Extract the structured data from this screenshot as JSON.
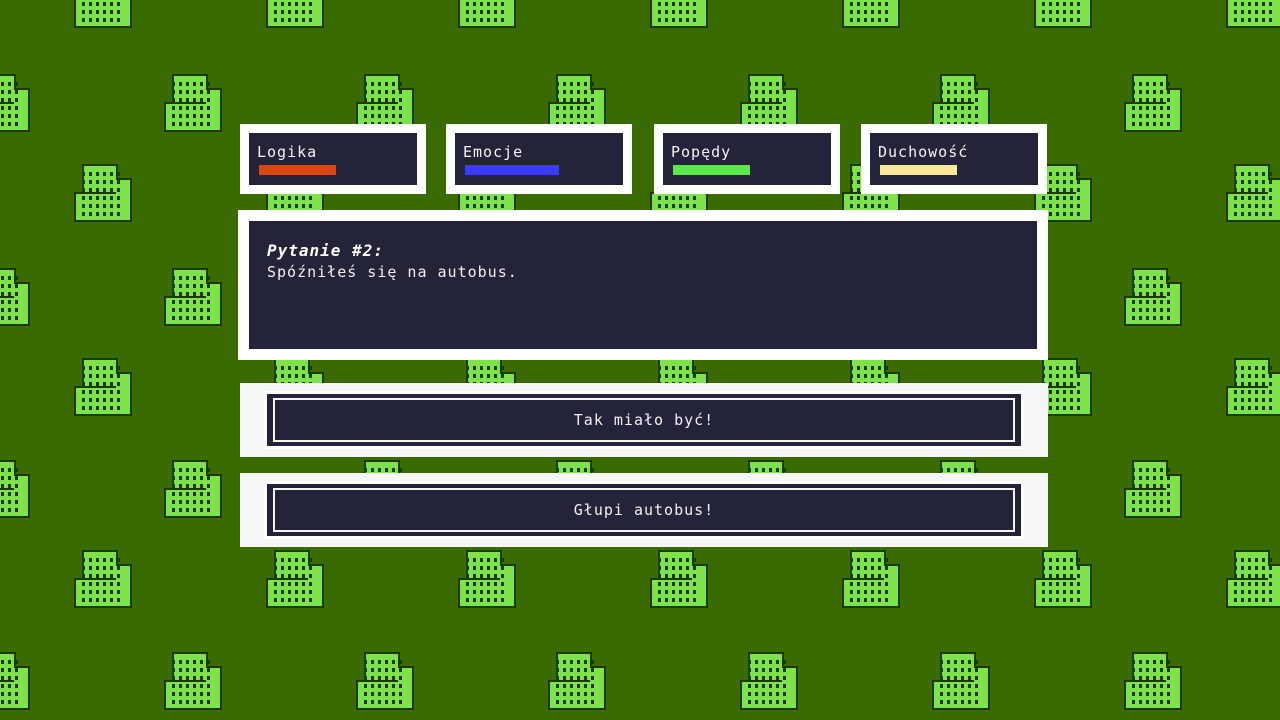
{
  "stats": [
    {
      "label": "Logika",
      "color": "#d9480f",
      "level": 0.45
    },
    {
      "label": "Emocje",
      "color": "#3b3bff",
      "level": 0.55
    },
    {
      "label": "Popędy",
      "color": "#5be84a",
      "level": 0.45
    },
    {
      "label": "Duchowość",
      "color": "#fbe89a",
      "level": 0.45
    }
  ],
  "question": {
    "title": "Pytanie #2:",
    "text": "Spóźniłeś się na autobus."
  },
  "answers": [
    {
      "label": "Tak miało być!"
    },
    {
      "label": "Głupi autobus!"
    }
  ],
  "colors": {
    "background": "#3a6b00",
    "sprite_light": "#7ee34a",
    "sprite_dark": "#1c3a00",
    "panel": "#23233a",
    "frame": "#ffffff"
  }
}
